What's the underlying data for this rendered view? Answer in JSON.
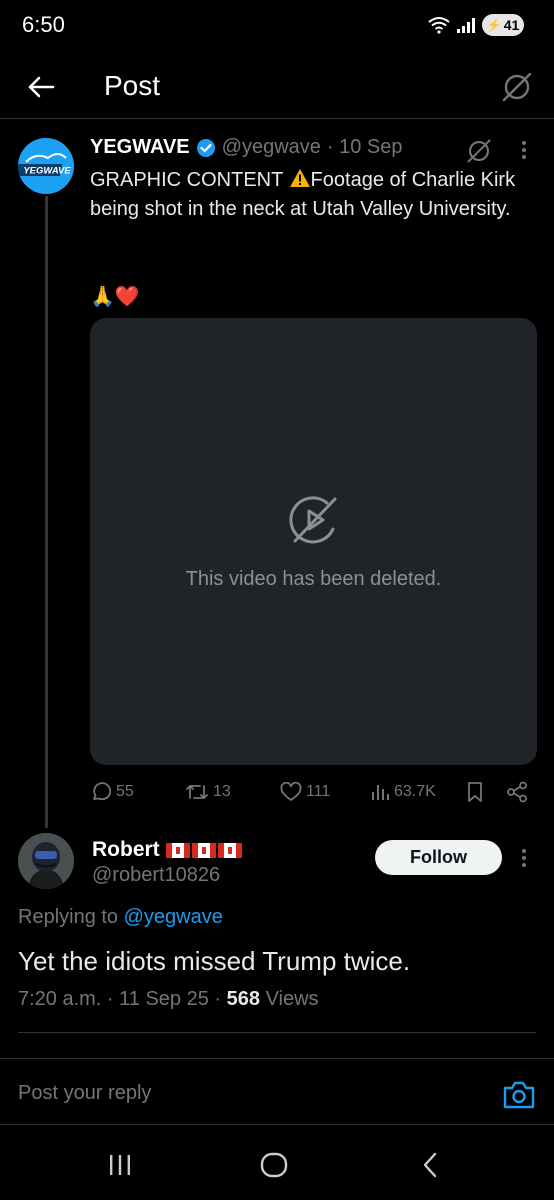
{
  "status_bar": {
    "time": "6:50",
    "battery": "41"
  },
  "header": {
    "title": "Post"
  },
  "post": {
    "author_name": "YEGWAVE",
    "handle": "@yegwave",
    "date": "· 10 Sep",
    "avatar_text": "YEGWAVE",
    "text_part1": "GRAPHIC CONTENT ",
    "text_part2": "Footage of Charlie Kirk being shot in the neck at Utah Valley University.",
    "emoji": "🙏❤️",
    "media_message": "This video has been deleted.",
    "stats": {
      "replies": "55",
      "reposts": "13",
      "likes": "111",
      "views": "63.7K"
    }
  },
  "reply": {
    "author_name": "Robert",
    "handle": "@robert10826",
    "follow_label": "Follow",
    "replying_prefix": "Replying to ",
    "replying_to": "@yegwave",
    "text": "Yet the idiots missed Trump twice.",
    "time_date": "7:20 a.m. · 11 Sep 25 · ",
    "views_count": "568",
    "views_label": " Views"
  },
  "compose": {
    "placeholder": "Post your reply"
  },
  "colors": {
    "background": "#000000",
    "accent": "#1d9bf0",
    "secondary_text": "#71767b",
    "media_background": "#202327"
  }
}
